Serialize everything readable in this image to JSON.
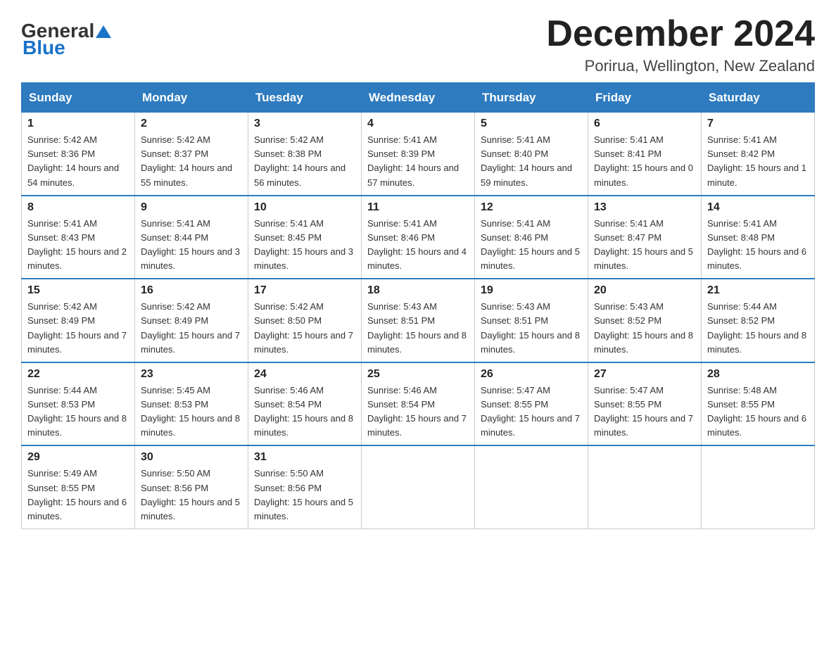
{
  "header": {
    "logo": {
      "general": "General",
      "blue": "Blue"
    },
    "title": "December 2024",
    "subtitle": "Porirua, Wellington, New Zealand"
  },
  "calendar": {
    "headers": [
      "Sunday",
      "Monday",
      "Tuesday",
      "Wednesday",
      "Thursday",
      "Friday",
      "Saturday"
    ],
    "weeks": [
      [
        {
          "day": "1",
          "sunrise": "5:42 AM",
          "sunset": "8:36 PM",
          "daylight": "14 hours and 54 minutes."
        },
        {
          "day": "2",
          "sunrise": "5:42 AM",
          "sunset": "8:37 PM",
          "daylight": "14 hours and 55 minutes."
        },
        {
          "day": "3",
          "sunrise": "5:42 AM",
          "sunset": "8:38 PM",
          "daylight": "14 hours and 56 minutes."
        },
        {
          "day": "4",
          "sunrise": "5:41 AM",
          "sunset": "8:39 PM",
          "daylight": "14 hours and 57 minutes."
        },
        {
          "day": "5",
          "sunrise": "5:41 AM",
          "sunset": "8:40 PM",
          "daylight": "14 hours and 59 minutes."
        },
        {
          "day": "6",
          "sunrise": "5:41 AM",
          "sunset": "8:41 PM",
          "daylight": "15 hours and 0 minutes."
        },
        {
          "day": "7",
          "sunrise": "5:41 AM",
          "sunset": "8:42 PM",
          "daylight": "15 hours and 1 minute."
        }
      ],
      [
        {
          "day": "8",
          "sunrise": "5:41 AM",
          "sunset": "8:43 PM",
          "daylight": "15 hours and 2 minutes."
        },
        {
          "day": "9",
          "sunrise": "5:41 AM",
          "sunset": "8:44 PM",
          "daylight": "15 hours and 3 minutes."
        },
        {
          "day": "10",
          "sunrise": "5:41 AM",
          "sunset": "8:45 PM",
          "daylight": "15 hours and 3 minutes."
        },
        {
          "day": "11",
          "sunrise": "5:41 AM",
          "sunset": "8:46 PM",
          "daylight": "15 hours and 4 minutes."
        },
        {
          "day": "12",
          "sunrise": "5:41 AM",
          "sunset": "8:46 PM",
          "daylight": "15 hours and 5 minutes."
        },
        {
          "day": "13",
          "sunrise": "5:41 AM",
          "sunset": "8:47 PM",
          "daylight": "15 hours and 5 minutes."
        },
        {
          "day": "14",
          "sunrise": "5:41 AM",
          "sunset": "8:48 PM",
          "daylight": "15 hours and 6 minutes."
        }
      ],
      [
        {
          "day": "15",
          "sunrise": "5:42 AM",
          "sunset": "8:49 PM",
          "daylight": "15 hours and 7 minutes."
        },
        {
          "day": "16",
          "sunrise": "5:42 AM",
          "sunset": "8:49 PM",
          "daylight": "15 hours and 7 minutes."
        },
        {
          "day": "17",
          "sunrise": "5:42 AM",
          "sunset": "8:50 PM",
          "daylight": "15 hours and 7 minutes."
        },
        {
          "day": "18",
          "sunrise": "5:43 AM",
          "sunset": "8:51 PM",
          "daylight": "15 hours and 8 minutes."
        },
        {
          "day": "19",
          "sunrise": "5:43 AM",
          "sunset": "8:51 PM",
          "daylight": "15 hours and 8 minutes."
        },
        {
          "day": "20",
          "sunrise": "5:43 AM",
          "sunset": "8:52 PM",
          "daylight": "15 hours and 8 minutes."
        },
        {
          "day": "21",
          "sunrise": "5:44 AM",
          "sunset": "8:52 PM",
          "daylight": "15 hours and 8 minutes."
        }
      ],
      [
        {
          "day": "22",
          "sunrise": "5:44 AM",
          "sunset": "8:53 PM",
          "daylight": "15 hours and 8 minutes."
        },
        {
          "day": "23",
          "sunrise": "5:45 AM",
          "sunset": "8:53 PM",
          "daylight": "15 hours and 8 minutes."
        },
        {
          "day": "24",
          "sunrise": "5:46 AM",
          "sunset": "8:54 PM",
          "daylight": "15 hours and 8 minutes."
        },
        {
          "day": "25",
          "sunrise": "5:46 AM",
          "sunset": "8:54 PM",
          "daylight": "15 hours and 7 minutes."
        },
        {
          "day": "26",
          "sunrise": "5:47 AM",
          "sunset": "8:55 PM",
          "daylight": "15 hours and 7 minutes."
        },
        {
          "day": "27",
          "sunrise": "5:47 AM",
          "sunset": "8:55 PM",
          "daylight": "15 hours and 7 minutes."
        },
        {
          "day": "28",
          "sunrise": "5:48 AM",
          "sunset": "8:55 PM",
          "daylight": "15 hours and 6 minutes."
        }
      ],
      [
        {
          "day": "29",
          "sunrise": "5:49 AM",
          "sunset": "8:55 PM",
          "daylight": "15 hours and 6 minutes."
        },
        {
          "day": "30",
          "sunrise": "5:50 AM",
          "sunset": "8:56 PM",
          "daylight": "15 hours and 5 minutes."
        },
        {
          "day": "31",
          "sunrise": "5:50 AM",
          "sunset": "8:56 PM",
          "daylight": "15 hours and 5 minutes."
        },
        null,
        null,
        null,
        null
      ]
    ]
  }
}
